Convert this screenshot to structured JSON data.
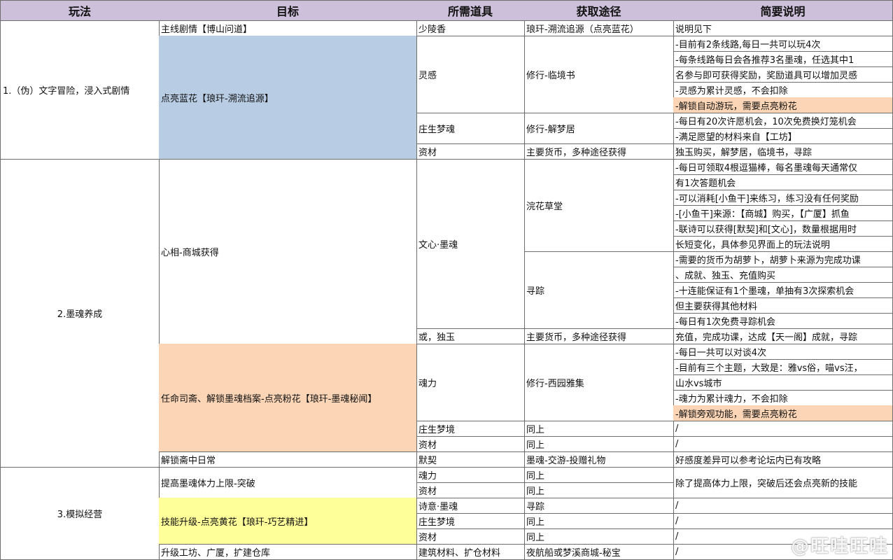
{
  "headers": [
    "玩法",
    "目标",
    "所需道具",
    "获取途径",
    "简要说明"
  ],
  "r1": {
    "play": "1.（伪）文字冒险，浸入式剧情",
    "goal1": "主线剧情【博山问道】",
    "goal2": "点亮蓝花【琅玕-溯流追源】",
    "item1": "少陵香",
    "route1": "琅玕-溯流追源（点亮蓝花）",
    "desc1": "说明见下",
    "item2": "灵感",
    "route2": "修行-临境书",
    "desc2": [
      "-目前有2条线路,每日一共可以玩4次",
      "-每条线路每日会各推荐3名墨魂，任选其中1",
      "名参与即可获得奖励，奖励道具可以增加灵感",
      "-灵感为累计灵感，不会扣除",
      "-解锁自动游玩，需要点亮粉花"
    ],
    "item3": "庄生梦魂",
    "route3": "修行-解梦居",
    "desc3": [
      "-每日有20次许愿机会，10次免费换灯笼机会",
      "-满足愿望的材料来自【工坊】"
    ],
    "item4": "资材",
    "route4": "主要货币，多种途径获得",
    "desc4": "独玉购买，解梦居，临境书，寻踪"
  },
  "r2": {
    "play": "2.墨魂养成",
    "goal1": "心相-商城获得",
    "goal2": "任命司斋、解锁墨魂档案-点亮粉花【琅玕-墨魂秘闻】",
    "goal3": "解锁斋中日常",
    "item1": "文心·墨魂",
    "route1a": "浣花草堂",
    "desc1a": [
      "-每日可领取4根逗猫棒，每名墨魂每天通常仅",
      "有1次答题机会",
      "-可以消耗[小鱼干]来练习，练习没有任何奖励",
      "-[小鱼干]来源：【商城】购买，【广厦】抓鱼",
      "-联诗可以获得[默契]和[文心]，数量根据用时",
      "长短变化，具体参见界面上的玩法说明"
    ],
    "route1b": "寻踪",
    "desc1b": [
      "-需要的货币为胡萝卜，胡萝卜来源为完成功课",
      "、成就、独玉、充值购买",
      "-十连能保证有1个墨魂，单抽有3次探索机会",
      "但主要获得其他材料",
      "-每日有1次免费寻踪机会"
    ],
    "item2": "或，独玉",
    "route2": "主要货币，多种途径获得",
    "desc2": "充值，完成功课，达成【天一阁】成就，寻踪",
    "item3": "魂力",
    "route3": "修行-西园雅集",
    "desc3": [
      "-每日一共可以对谈4次",
      "-目前有三个主题，大致是：雅vs俗，喵vs汪，",
      "山水vs城市",
      "-魂力为累计魂力，不会扣除",
      "-解锁旁观功能，需要点亮粉花"
    ],
    "item4": "庄生梦境",
    "route4": "同上",
    "desc4": "/",
    "item5": "资材",
    "route5": "同上",
    "desc5": "/",
    "item6": "默契",
    "route6": "墨魂-交游-投赠礼物",
    "desc6": "好感度差异可以参考论坛内已有攻略"
  },
  "r3": {
    "play": "3.模拟经营",
    "goal1": "提高墨魂体力上限-突破",
    "goal2": "技能升级-点亮黄花【琅玕-巧艺精进】",
    "goal3": "升级工坊、广厦，扩建仓库",
    "item1": "魂力",
    "route1": "同上",
    "item2": "资材",
    "route2": "同上",
    "desc12": "除了提高体力上限，突破后还会点亮新的技能",
    "item3": "诗意·墨魂",
    "route3": "寻踪",
    "desc3": "/",
    "item4": "庄生梦境",
    "route4": "同上",
    "desc4": "/",
    "item5": "资材",
    "route5": "同上",
    "desc5": "/",
    "item6": "建筑材料、扩仓材料",
    "route6": "夜航船或梦溪商城-秘宝",
    "desc6": "/"
  },
  "watermark": "@旺哇旺哇"
}
